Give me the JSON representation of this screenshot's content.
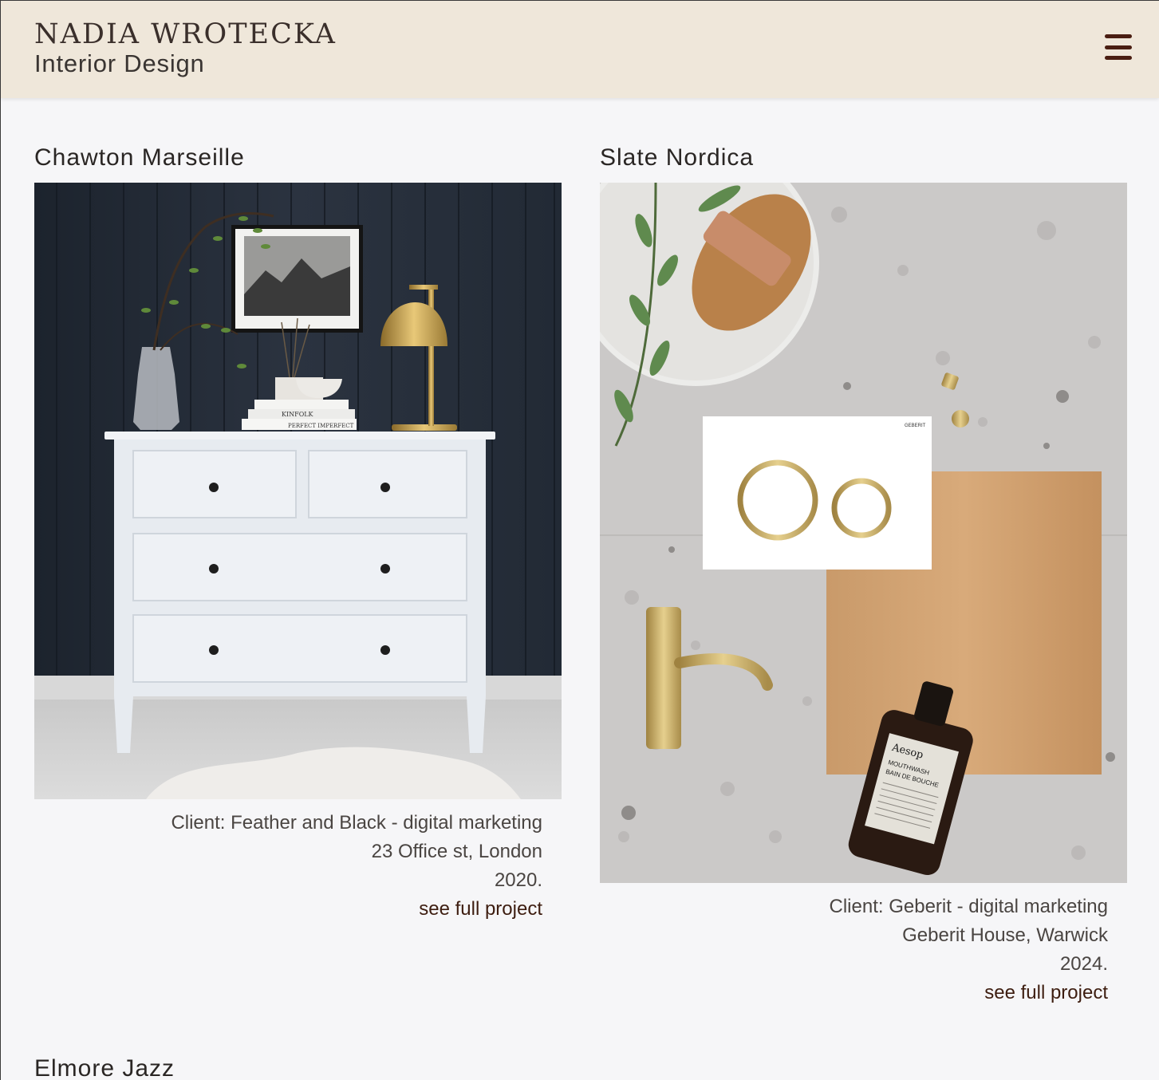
{
  "header": {
    "brand_name": "NADIA WROTECKA",
    "brand_subtitle": "Interior Design",
    "menu_icon": "hamburger-menu-icon"
  },
  "projects": [
    {
      "title": "Chawton Marseille",
      "client": "Client: Feather and Black - digital marketing",
      "address": "23 Office st, London",
      "year": "2020.",
      "link": "see full project",
      "book_titles": [
        "KINFOLK",
        "PERFECT IMPERFECT"
      ]
    },
    {
      "title": "Slate Nordica",
      "client": "Client: Geberit - digital marketing",
      "address": "Geberit House, Warwick",
      "year": "2024.",
      "link": "see full project",
      "product_labels": [
        "GEBERIT",
        "Aesop",
        "MOUTHWASH",
        "BAIN DE BOUCHE"
      ]
    },
    {
      "title": "Elmore Jazz"
    }
  ],
  "colors": {
    "header_bg": "#efe7da",
    "page_bg": "#f6f6f8",
    "accent_link": "#3d1d10",
    "menu_icon": "#4a1e12"
  }
}
